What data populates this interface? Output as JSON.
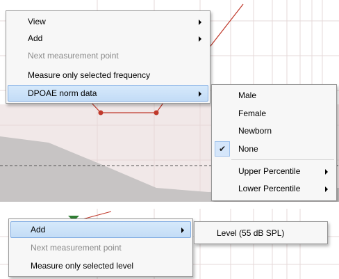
{
  "top_menu": {
    "items": [
      {
        "label": "View",
        "has_submenu": true,
        "enabled": true
      },
      {
        "label": "Add",
        "has_submenu": true,
        "enabled": true
      },
      {
        "label": "Next measurement point",
        "has_submenu": false,
        "enabled": false
      },
      {
        "label": "Measure only selected  frequency",
        "has_submenu": false,
        "enabled": true
      },
      {
        "label": "DPOAE norm data",
        "has_submenu": true,
        "enabled": true,
        "highlighted": true
      }
    ]
  },
  "norm_submenu": {
    "items": [
      {
        "label": "Male",
        "checked": false
      },
      {
        "label": "Female",
        "checked": false
      },
      {
        "label": "Newborn",
        "checked": false
      },
      {
        "label": "None",
        "checked": true
      },
      {
        "label": "Upper Percentile",
        "has_submenu": true
      },
      {
        "label": "Lower Percentile",
        "has_submenu": true
      }
    ]
  },
  "bottom_menu": {
    "items": [
      {
        "label": "Add",
        "has_submenu": true,
        "enabled": true,
        "highlighted": true
      },
      {
        "label": "Next measurement point",
        "has_submenu": false,
        "enabled": false
      },
      {
        "label": "Measure only selected  level",
        "has_submenu": false,
        "enabled": true
      }
    ]
  },
  "add_submenu": {
    "items": [
      {
        "label": "Level (55 dB SPL)"
      }
    ]
  },
  "icons": {
    "checkmark": "checkmark-icon",
    "submenu_arrow": "submenu-arrow-icon"
  },
  "colors": {
    "menu_background": "#f7f7f7",
    "highlight": "#c3dcf6",
    "highlight_border": "#84aee3",
    "disabled_text": "#8a8a8a",
    "plot_line": "#c0392b",
    "norm_area": "#bdbdbd"
  }
}
